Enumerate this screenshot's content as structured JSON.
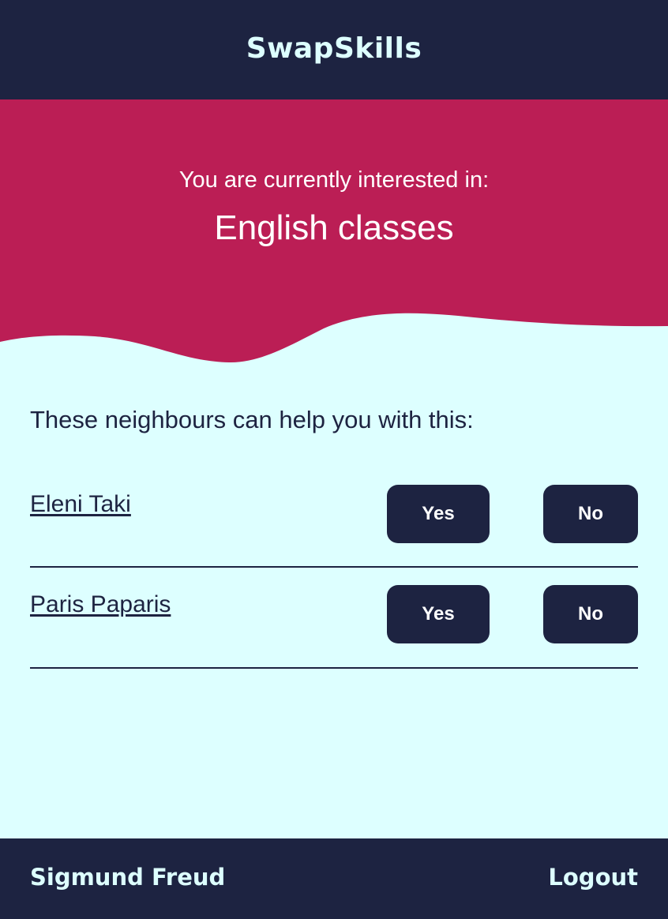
{
  "app": {
    "brand": "SwapSkills"
  },
  "hero": {
    "label": "You are currently interested in:",
    "title": "English classes"
  },
  "main": {
    "intro": "These neighbours can help you with this:",
    "neighbours": [
      {
        "name": "Eleni Taki",
        "yes_label": "Yes",
        "no_label": "No"
      },
      {
        "name": "Paris Paparis",
        "yes_label": "Yes",
        "no_label": "No"
      }
    ]
  },
  "footer": {
    "user_name": "Sigmund Freud",
    "logout_label": "Logout"
  },
  "colors": {
    "navy": "#1d2341",
    "crimson": "#bb1e55",
    "background": "#ddffff"
  }
}
